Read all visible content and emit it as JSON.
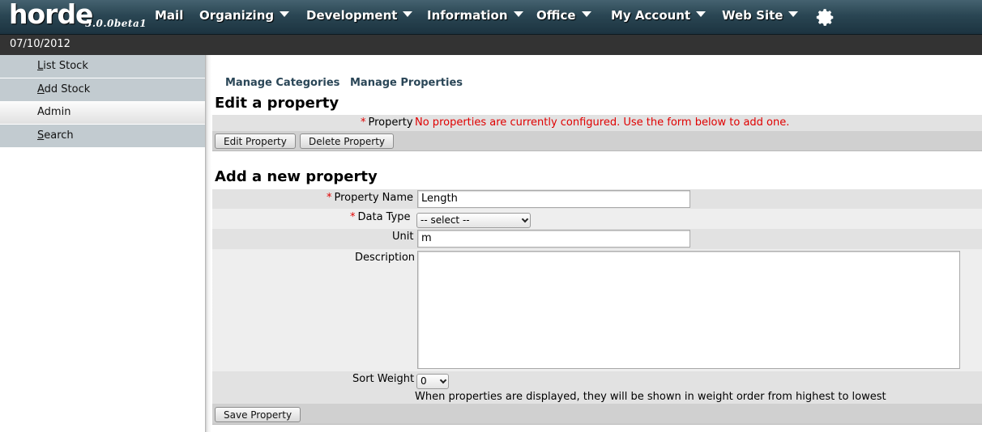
{
  "app": {
    "logo_text": "horde",
    "version": "5.0.0beta1",
    "date": "07/10/2012"
  },
  "nav": {
    "mail": "Mail",
    "organizing": "Organizing",
    "development": "Development",
    "information": "Information",
    "office": "Office",
    "my_account": "My Account",
    "web_site": "Web Site",
    "settings_icon": "gear-icon"
  },
  "sidebar": {
    "items": [
      {
        "label": "List Stock",
        "accesskey": "L",
        "rest": "ist Stock"
      },
      {
        "label": "Add Stock",
        "accesskey": "A",
        "rest": "dd Stock"
      },
      {
        "label": "Admin",
        "accesskey": "",
        "rest": "Admin"
      },
      {
        "label": "Search",
        "accesskey": "S",
        "rest": "earch"
      }
    ],
    "active": "Admin"
  },
  "tabs": {
    "manage_categories": "Manage Categories",
    "manage_properties": "Manage Properties"
  },
  "edit_section": {
    "title": "Edit a property",
    "required_mark": "*",
    "property_label": "Property",
    "error_message": "No properties are currently configured. Use the form below to add one.",
    "edit_button": "Edit Property",
    "delete_button": "Delete Property"
  },
  "add_section": {
    "title": "Add a new property",
    "required_mark": "*",
    "property_name_label": "Property Name",
    "property_name_value": "Length",
    "data_type_label": "Data Type",
    "data_type_selected": "-- select --",
    "unit_label": "Unit",
    "unit_value": "m",
    "description_label": "Description",
    "description_value": "",
    "sort_weight_label": "Sort Weight",
    "sort_weight_selected": "0",
    "sort_weight_help": "When properties are displayed, they will be shown in weight order from highest to lowest",
    "save_button": "Save Property"
  },
  "colors": {
    "topbar": "#2a4653",
    "datebar": "#333333",
    "sidebar_item": "#c2cbd0",
    "tab_link": "#2a4657",
    "error_text": "#e00000",
    "band_dark": "#e2e2e2",
    "band_light": "#eeeeee",
    "band_button": "#d0d0d0"
  }
}
